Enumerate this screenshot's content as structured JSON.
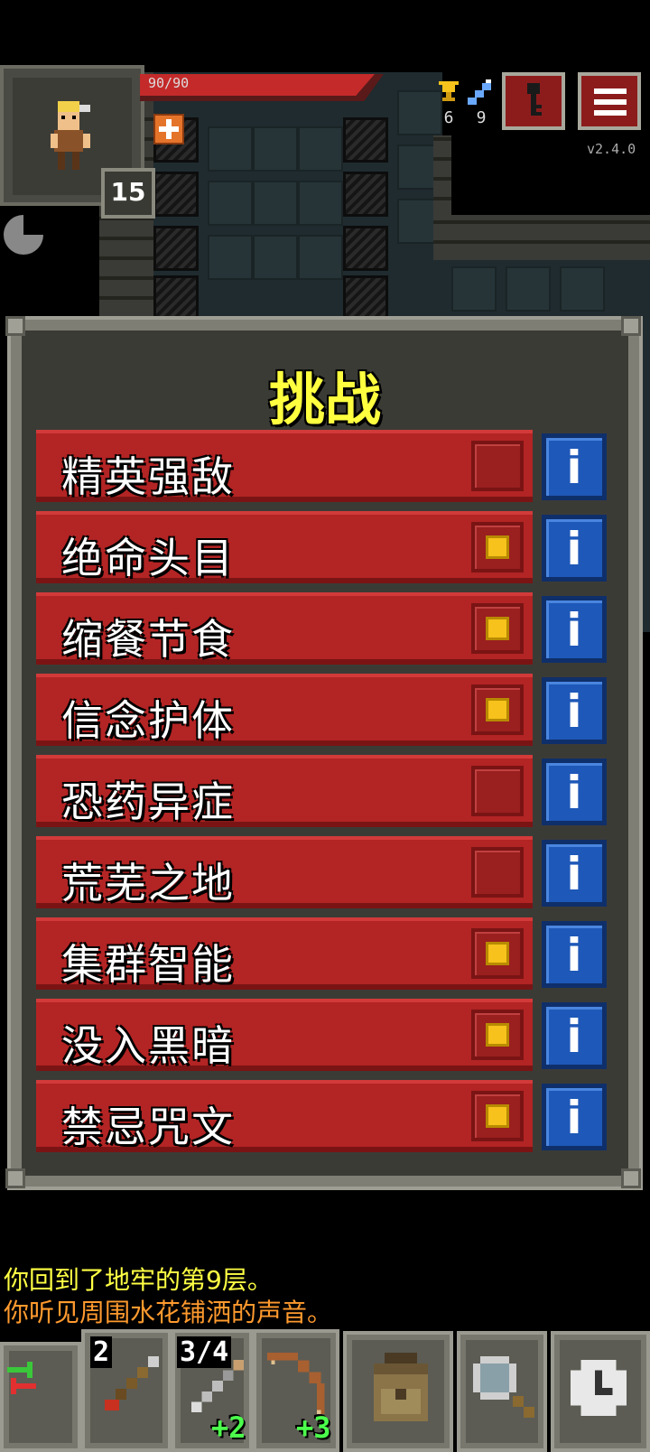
{
  "hud": {
    "hp_text": "90/90",
    "hp_fraction": 1.0,
    "hero_level": "15",
    "gold_icon": "trophy-icon",
    "gold_count": "6",
    "depth_icon": "stairs-icon",
    "depth_count": "9",
    "journal_icon": "key-icon",
    "menu_icon": "menu-icon",
    "version": "v2.4.0"
  },
  "challenges": {
    "title": "挑战",
    "info_label": "i",
    "items": [
      {
        "label": "精英强敌",
        "checked": false
      },
      {
        "label": "绝命头目",
        "checked": true
      },
      {
        "label": "缩餐节食",
        "checked": true
      },
      {
        "label": "信念护体",
        "checked": true
      },
      {
        "label": "恐药异症",
        "checked": false
      },
      {
        "label": "荒芜之地",
        "checked": false
      },
      {
        "label": "集群智能",
        "checked": true
      },
      {
        "label": "没入黑暗",
        "checked": true
      },
      {
        "label": "禁忌咒文",
        "checked": true
      }
    ]
  },
  "log": {
    "line1": "你回到了地牢的第9层。",
    "line2": "你听见周围水花铺洒的声音。"
  },
  "toolbar": {
    "swap_icon": "swap-icon",
    "slot1_count": "2",
    "slot1_icon": "dart-icon",
    "slot2_count": "3/4",
    "slot2_bonus": "+2",
    "slot2_icon": "javelin-icon",
    "slot3_bonus": "+3",
    "slot3_icon": "bow-icon",
    "backpack_icon": "backpack-icon",
    "search_icon": "magnifier-icon",
    "wait_icon": "clock-icon"
  },
  "colors": {
    "title": "#ffff40",
    "row": "#b32424",
    "info": "#1e58b8",
    "check": "#f6c21b",
    "log_line1": "#ffff44",
    "log_line2": "#ff9a2e"
  }
}
